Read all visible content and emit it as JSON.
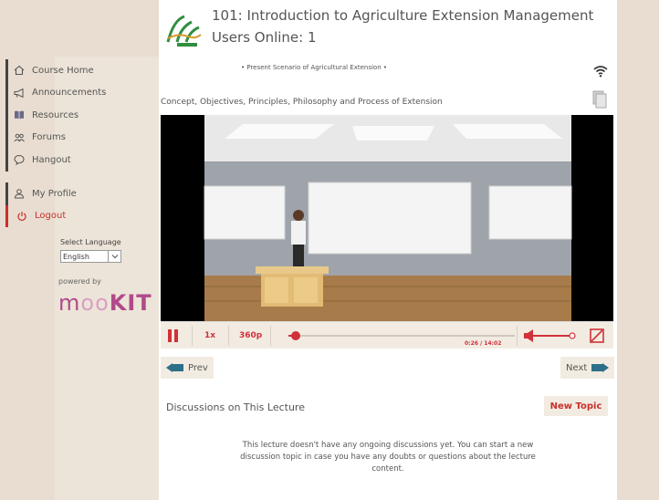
{
  "header": {
    "course_title": "101: Introduction to Agriculture Extension Management",
    "users_online": "Users Online: 1"
  },
  "sidebar": {
    "items": [
      {
        "label": "Course Home",
        "icon": "home-icon"
      },
      {
        "label": "Announcements",
        "icon": "megaphone-icon"
      },
      {
        "label": "Resources",
        "icon": "book-icon"
      },
      {
        "label": "Forums",
        "icon": "users-icon"
      },
      {
        "label": "Hangout",
        "icon": "chat-bubble-icon"
      }
    ],
    "profile_label": "My Profile",
    "logout_label": "Logout",
    "language_label": "Select Language",
    "language_value": "English",
    "powered_by": "powered by",
    "brand": {
      "m": "m",
      "oo": "oo",
      "kit": "KIT"
    }
  },
  "lecture": {
    "scenario": "• Present Scenario of Agricultural Extension •",
    "title": "Concept, Objectives, Principles, Philosophy and Process of Extension"
  },
  "player": {
    "speed": "1x",
    "quality": "360p",
    "time": "0:26 / 14:02",
    "progress": 0.031,
    "volume": 0.8,
    "accent_color": "#d0313a"
  },
  "navigation": {
    "prev_label": "Prev",
    "next_label": "Next"
  },
  "discussions": {
    "title": "Discussions on This Lecture",
    "new_topic_label": "New Topic",
    "empty_message": "This lecture doesn't have any ongoing discussions yet. You can start a new discussion topic in case you have any doubts or questions about the lecture content."
  }
}
